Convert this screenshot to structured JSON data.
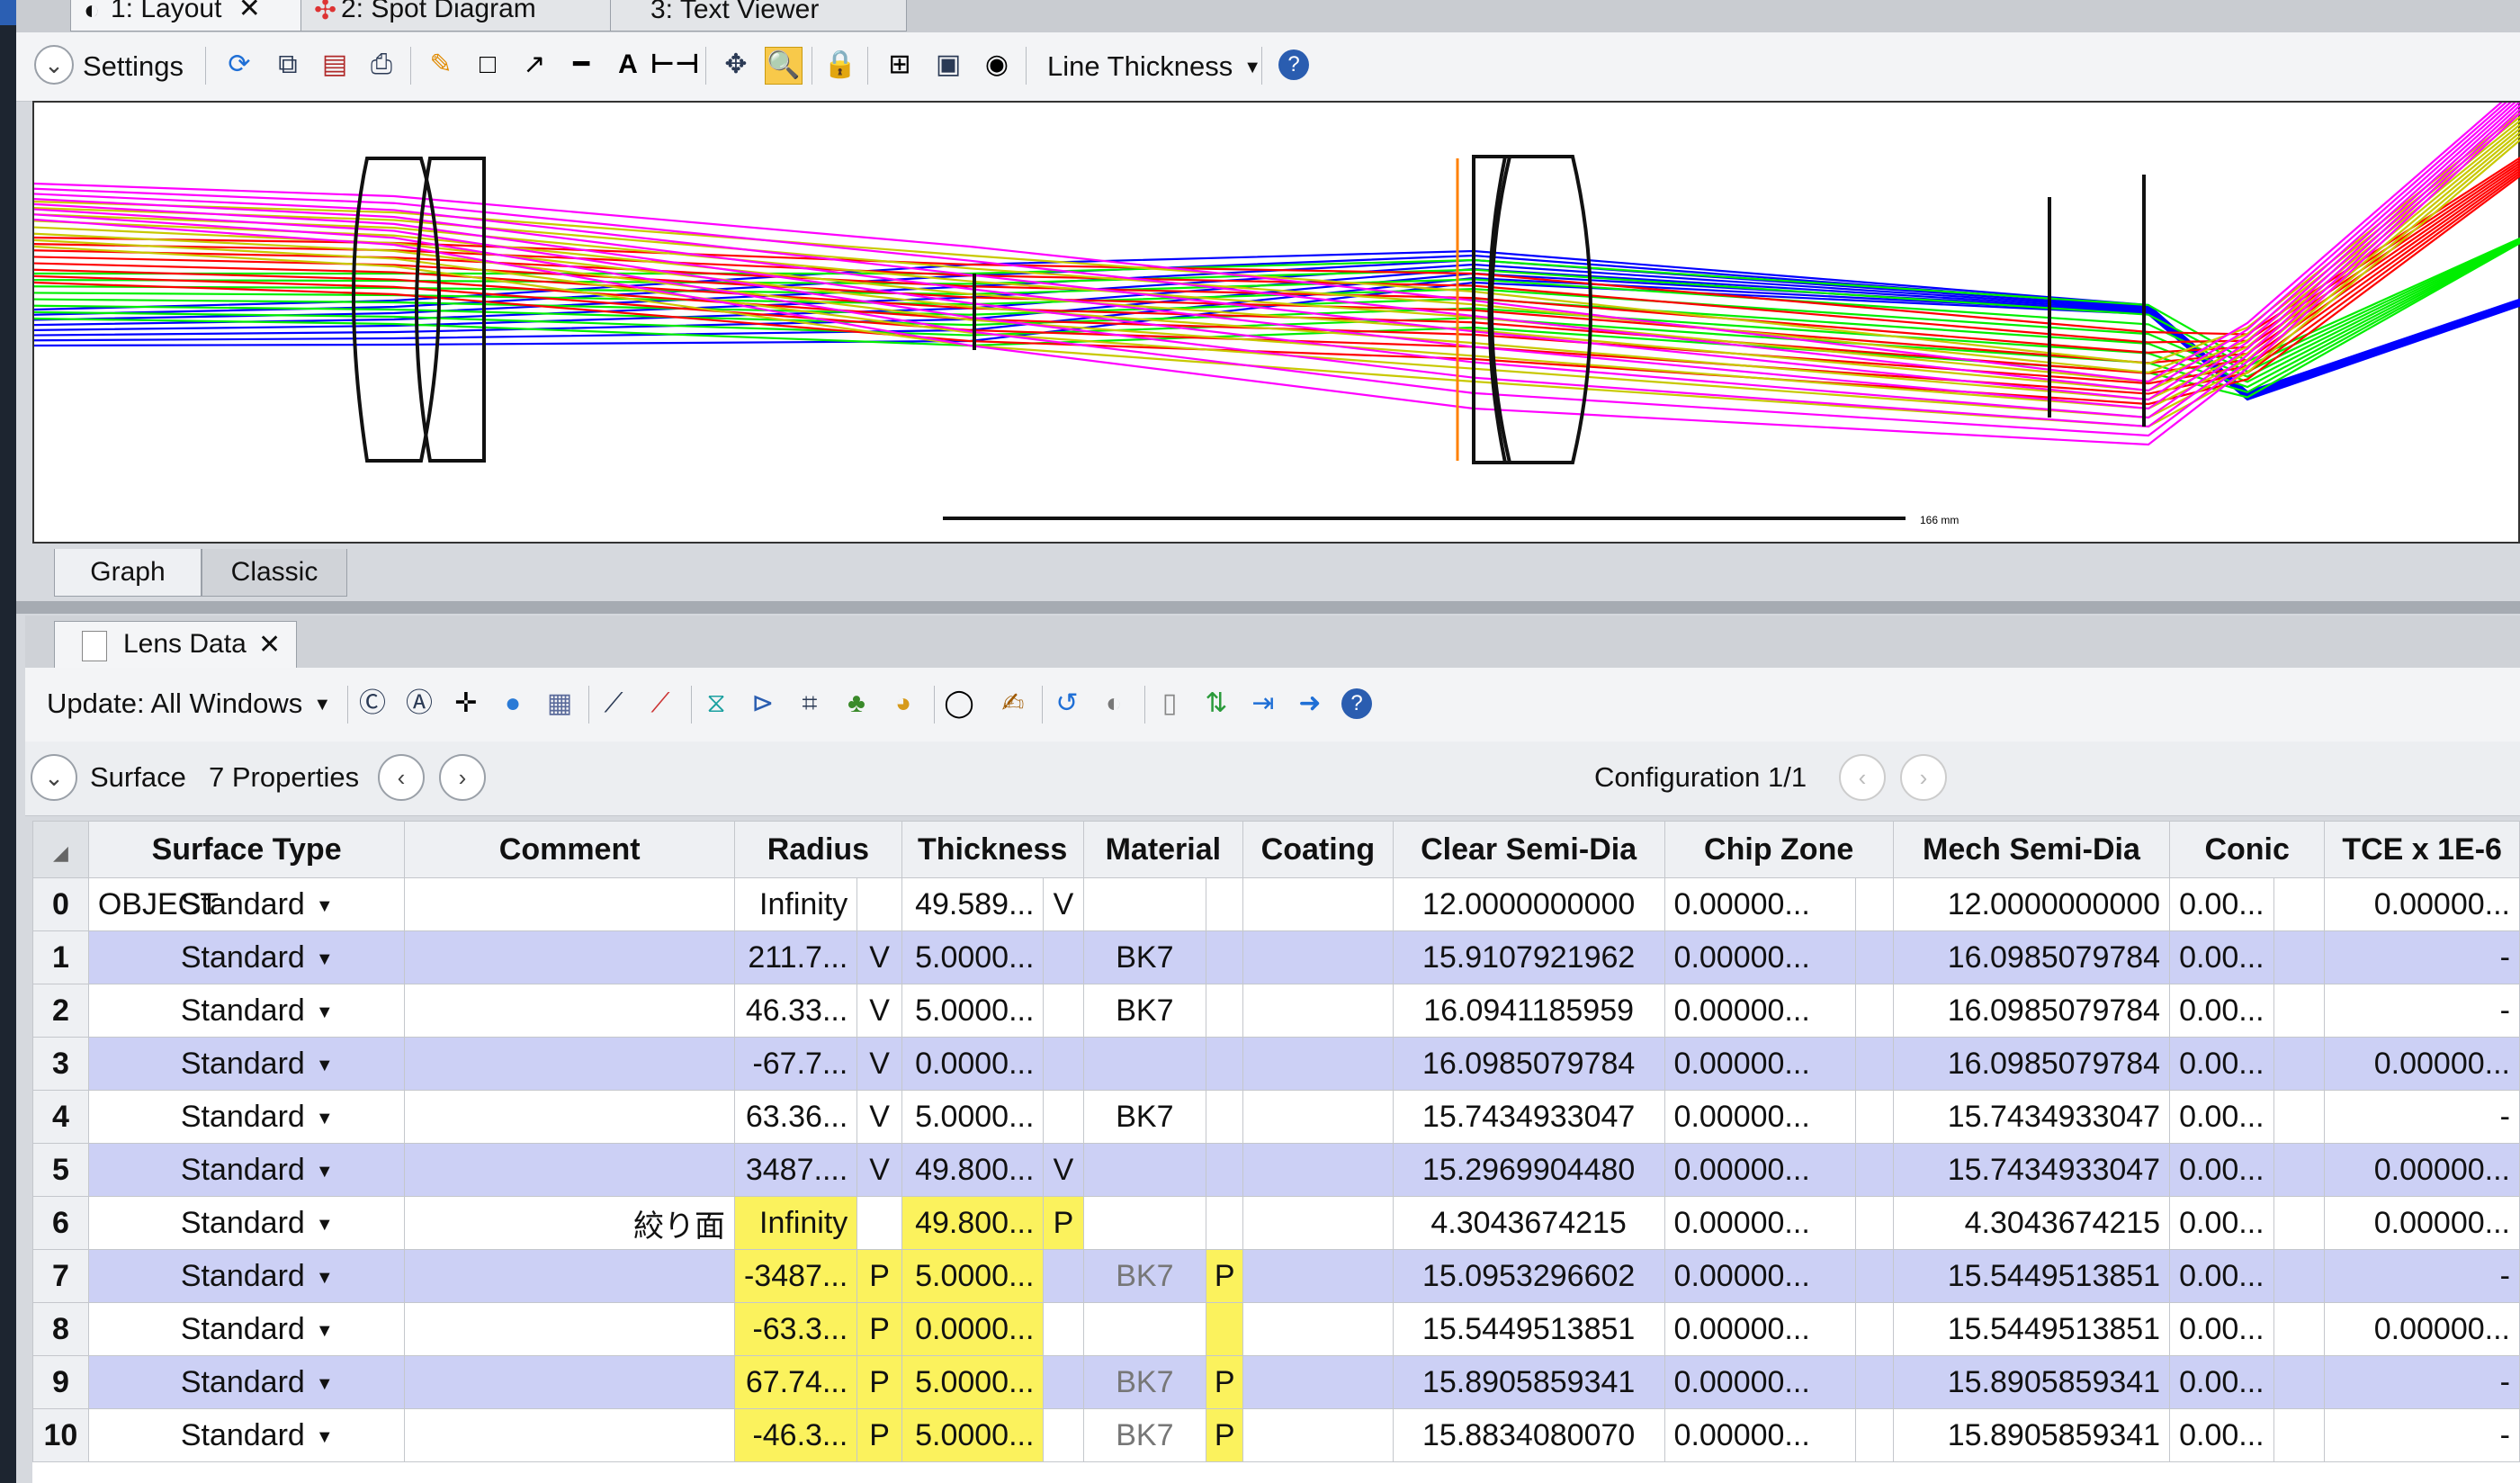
{
  "doc_tabs": [
    {
      "label": "1: Layout",
      "active": true,
      "closable": true
    },
    {
      "label": "2: Spot Diagram",
      "active": false
    },
    {
      "label": "3: Text Viewer",
      "active": false
    }
  ],
  "layout_toolbar": {
    "settings_label": "Settings",
    "line_thickness_label": "Line Thickness"
  },
  "layout_plot": {
    "scale_bar_label": "166 mm",
    "ray_colors": [
      "#0000ff",
      "#00ee00",
      "#ff0000",
      "#c8c800",
      "#ff00ff"
    ]
  },
  "layout_bottom_tabs": [
    {
      "label": "Graph",
      "active": true
    },
    {
      "label": "Classic",
      "active": false
    }
  ],
  "lens_data": {
    "tab_label": "Lens Data",
    "update_label": "Update: All Windows",
    "surface_label": "Surface",
    "properties_label": "7 Properties",
    "configuration_label": "Configuration 1/1",
    "columns": [
      "Surface Type",
      "Comment",
      "Radius",
      "Thickness",
      "Material",
      "Coating",
      "Clear Semi-Dia",
      "Chip Zone",
      "Mech Semi-Dia",
      "Conic",
      "TCE x 1E-6"
    ],
    "rows": [
      {
        "num": "0",
        "name": "OBJECT",
        "type": "Standard",
        "comment": "",
        "radius": "Infinity",
        "r_solve": "",
        "thickness": "49.589...",
        "t_solve": "V",
        "material": "",
        "m_solve": "",
        "coating": "",
        "clear": "12.0000000000",
        "chip": "0.00000...",
        "mech": "12.0000000000",
        "conic": "0.00...",
        "tce": "0.00000..."
      },
      {
        "num": "1",
        "name": "",
        "type": "Standard",
        "comment": "",
        "radius": "211.7...",
        "r_solve": "V",
        "thickness": "5.0000...",
        "t_solve": "",
        "material": "BK7",
        "m_solve": "",
        "coating": "",
        "clear": "15.9107921962",
        "chip": "0.00000...",
        "mech": "16.0985079784",
        "conic": "0.00...",
        "tce": "-"
      },
      {
        "num": "2",
        "name": "",
        "type": "Standard",
        "comment": "",
        "radius": "46.33...",
        "r_solve": "V",
        "thickness": "5.0000...",
        "t_solve": "",
        "material": "BK7",
        "m_solve": "",
        "coating": "",
        "clear": "16.0941185959",
        "chip": "0.00000...",
        "mech": "16.0985079784",
        "conic": "0.00...",
        "tce": "-"
      },
      {
        "num": "3",
        "name": "",
        "type": "Standard",
        "comment": "",
        "radius": "-67.7...",
        "r_solve": "V",
        "thickness": "0.0000...",
        "t_solve": "",
        "material": "",
        "m_solve": "",
        "coating": "",
        "clear": "16.0985079784",
        "chip": "0.00000...",
        "mech": "16.0985079784",
        "conic": "0.00...",
        "tce": "0.00000..."
      },
      {
        "num": "4",
        "name": "",
        "type": "Standard",
        "comment": "",
        "radius": "63.36...",
        "r_solve": "V",
        "thickness": "5.0000...",
        "t_solve": "",
        "material": "BK7",
        "m_solve": "",
        "coating": "",
        "clear": "15.7434933047",
        "chip": "0.00000...",
        "mech": "15.7434933047",
        "conic": "0.00...",
        "tce": "-"
      },
      {
        "num": "5",
        "name": "",
        "type": "Standard",
        "comment": "",
        "radius": "3487....",
        "r_solve": "V",
        "thickness": "49.800...",
        "t_solve": "V",
        "material": "",
        "m_solve": "",
        "coating": "",
        "clear": "15.2969904480",
        "chip": "0.00000...",
        "mech": "15.7434933047",
        "conic": "0.00...",
        "tce": "0.00000..."
      },
      {
        "num": "6",
        "name": "",
        "type": "Standard",
        "comment": "絞り面",
        "radius": "Infinity",
        "r_solve": "",
        "thickness": "49.800...",
        "t_solve": "P",
        "material": "",
        "m_solve": "",
        "coating": "",
        "clear": "4.3043674215",
        "chip": "0.00000...",
        "mech": "4.3043674215",
        "conic": "0.00...",
        "tce": "0.00000..."
      },
      {
        "num": "7",
        "name": "",
        "type": "Standard",
        "comment": "",
        "radius": "-3487...",
        "r_solve": "P",
        "thickness": "5.0000...",
        "t_solve": "",
        "material": "BK7",
        "m_solve": "P",
        "coating": "",
        "clear": "15.0953296602",
        "chip": "0.00000...",
        "mech": "15.5449513851",
        "conic": "0.00...",
        "tce": "-"
      },
      {
        "num": "8",
        "name": "",
        "type": "Standard",
        "comment": "",
        "radius": "-63.3...",
        "r_solve": "P",
        "thickness": "0.0000...",
        "t_solve": "",
        "material": "",
        "m_solve": "",
        "coating": "",
        "clear": "15.5449513851",
        "chip": "0.00000...",
        "mech": "15.5449513851",
        "conic": "0.00...",
        "tce": "0.00000..."
      },
      {
        "num": "9",
        "name": "",
        "type": "Standard",
        "comment": "",
        "radius": "67.74...",
        "r_solve": "P",
        "thickness": "5.0000...",
        "t_solve": "",
        "material": "BK7",
        "m_solve": "P",
        "coating": "",
        "clear": "15.8905859341",
        "chip": "0.00000...",
        "mech": "15.8905859341",
        "conic": "0.00...",
        "tce": "-"
      },
      {
        "num": "10",
        "name": "",
        "type": "Standard",
        "comment": "",
        "radius": "-46.3...",
        "r_solve": "P",
        "thickness": "5.0000...",
        "t_solve": "",
        "material": "BK7",
        "m_solve": "P",
        "coating": "",
        "clear": "15.8834080070",
        "chip": "0.00000...",
        "mech": "15.8905859341",
        "conic": "0.00...",
        "tce": "-"
      }
    ]
  }
}
